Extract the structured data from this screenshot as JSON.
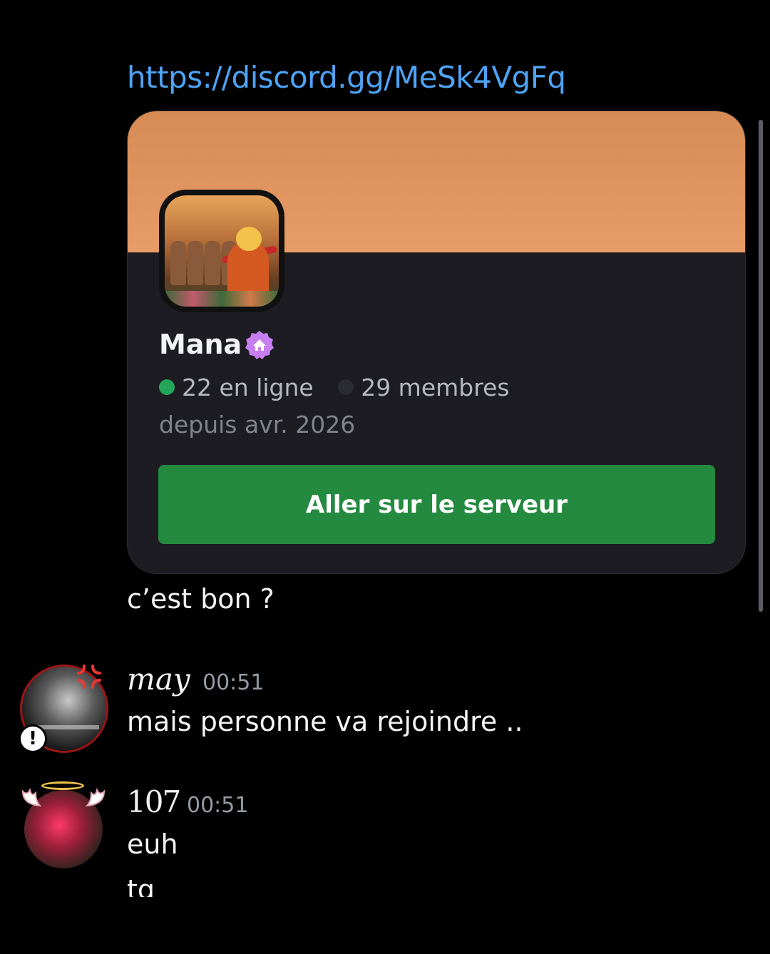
{
  "message_link": "https://discord.gg/MeSk4VgFq",
  "invite": {
    "guild_name": "Mana",
    "online": "22 en ligne",
    "members": "29 membres",
    "since": "depuis avr. 2026",
    "join_button": "Aller sur le serveur",
    "icons": {
      "badge": "community-badge-icon",
      "guild": "guild-icon"
    },
    "colors": {
      "banner": "#e09560",
      "button": "#248a3f",
      "online_dot": "#23a55a"
    }
  },
  "messages": [
    {
      "text": "c’est bon ?"
    },
    {
      "author": "may",
      "time": "00:51",
      "text": "mais personne va rejoindre .."
    },
    {
      "author": "107",
      "time": "00:51",
      "lines": [
        "euh",
        "tg"
      ]
    }
  ]
}
